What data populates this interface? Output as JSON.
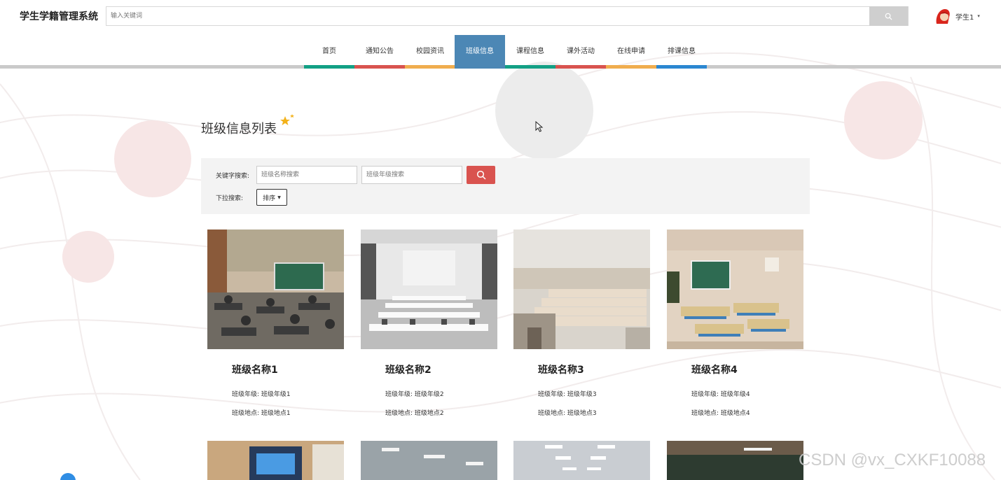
{
  "header": {
    "brand": "学生学籍管理系统",
    "search_placeholder": "输入关键词",
    "user_name": "学生1",
    "user_caret": "▾"
  },
  "nav": {
    "items": [
      {
        "label": "首页",
        "color": "#13a085"
      },
      {
        "label": "通知公告",
        "color": "#d9534f"
      },
      {
        "label": "校园资讯",
        "color": "#f0ad4e"
      },
      {
        "label": "班级信息",
        "color": "#4c87b5",
        "active": true
      },
      {
        "label": "课程信息",
        "color": "#13a085"
      },
      {
        "label": "课外活动",
        "color": "#d9534f"
      },
      {
        "label": "在线申请",
        "color": "#f0ad4e"
      },
      {
        "label": "排课信息",
        "color": "#2b87d1"
      }
    ]
  },
  "main": {
    "title": "班级信息列表",
    "filter": {
      "keyword_label": "关键字搜索:",
      "name_placeholder": "班级名称搜索",
      "grade_placeholder": "班级年级搜索",
      "dropdown_label": "下拉搜索:",
      "sort_label": "排序"
    },
    "cards": [
      {
        "title": "班级名称1",
        "grade": "班级年级: 班级年级1",
        "location": "班级地点: 班级地点1"
      },
      {
        "title": "班级名称2",
        "grade": "班级年级: 班级年级2",
        "location": "班级地点: 班级地点2"
      },
      {
        "title": "班级名称3",
        "grade": "班级年级: 班级年级3",
        "location": "班级地点: 班级地点3"
      },
      {
        "title": "班级名称4",
        "grade": "班级年级: 班级年级4",
        "location": "班级地点: 班级地点4"
      }
    ]
  },
  "watermark": "CSDN @vx_CXKF10088",
  "colors": {
    "accent_red": "#d9534f",
    "active_nav": "#4c87b5",
    "filter_bg": "#f3f3f3"
  }
}
